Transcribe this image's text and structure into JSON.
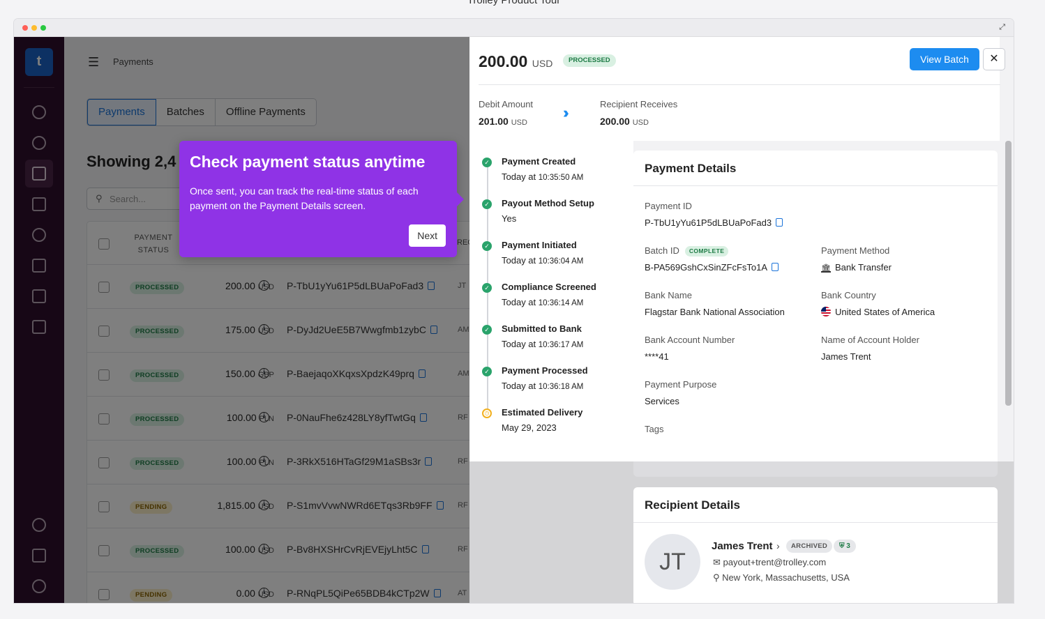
{
  "tour_title": "Trolley Product Tour",
  "app": {
    "logo_letter": "t",
    "breadcrumb": "Payments"
  },
  "tabs": [
    "Payments",
    "Batches",
    "Offline Payments"
  ],
  "showing": "Showing 2,4",
  "search_placeholder": "Search...",
  "table": {
    "header_status": "PAYMENT STATUS",
    "header_rec": "REC",
    "rows": [
      {
        "status": "PROCESSED",
        "amount": "200.00",
        "currency": "USD",
        "id": "P-TbU1yYu61P5dLBUaPoFad3",
        "rec": "JT"
      },
      {
        "status": "PROCESSED",
        "amount": "175.00",
        "currency": "USD",
        "id": "P-DyJd2UeE5B7Wwgfmb1zybC",
        "rec": "AM"
      },
      {
        "status": "PROCESSED",
        "amount": "150.00",
        "currency": "GBP",
        "id": "P-BaejaqoXKqxsXpdzK49prq",
        "rec": "AM"
      },
      {
        "status": "PROCESSED",
        "amount": "100.00",
        "currency": "PLN",
        "id": "P-0NauFhe6z428LY8yfTwtGq",
        "rec": "RF"
      },
      {
        "status": "PROCESSED",
        "amount": "100.00",
        "currency": "PLN",
        "id": "P-3RkX516HTaGf29M1aSBs3r",
        "rec": "RF"
      },
      {
        "status": "PENDING",
        "amount": "1,815.00",
        "currency": "USD",
        "id": "P-S1mvVvwNWRd6ETqs3Rb9FF",
        "rec": "RF"
      },
      {
        "status": "PROCESSED",
        "amount": "100.00",
        "currency": "USD",
        "id": "P-Bv8HXSHrCvRjEVEjyLht5C",
        "rec": "RF"
      },
      {
        "status": "PENDING",
        "amount": "0.00",
        "currency": "USD",
        "id": "P-RNqPL5QiPe65BDB4kCTp2W",
        "rec": "AT"
      }
    ]
  },
  "popover": {
    "title": "Check payment status anytime",
    "body": "Once sent, you can track the real-time status of each payment on the Payment Details screen.",
    "next": "Next",
    "color": "#8f33e6"
  },
  "panel": {
    "amount": "200.00",
    "currency": "USD",
    "status": "PROCESSED",
    "view_batch": "View Batch",
    "close": "✕",
    "debit_label": "Debit Amount",
    "debit_value": "201.00",
    "debit_currency": "USD",
    "recipient_label": "Recipient Receives",
    "recipient_value": "200.00",
    "recipient_currency": "USD",
    "timeline": [
      {
        "title": "Payment Created",
        "sub_main": "Today at ",
        "sub_time": "10:35:50 AM"
      },
      {
        "title": "Payout Method Setup",
        "sub_main": "Yes",
        "sub_time": ""
      },
      {
        "title": "Payment Initiated",
        "sub_main": "Today at ",
        "sub_time": "10:36:04 AM"
      },
      {
        "title": "Compliance Screened",
        "sub_main": "Today at ",
        "sub_time": "10:36:14 AM"
      },
      {
        "title": "Submitted to Bank",
        "sub_main": "Today at ",
        "sub_time": "10:36:17 AM"
      },
      {
        "title": "Payment Processed",
        "sub_main": "Today at ",
        "sub_time": "10:36:18 AM"
      },
      {
        "title": "Estimated Delivery",
        "sub_main": "May 29, 2023",
        "sub_time": ""
      }
    ],
    "details": {
      "title": "Payment Details",
      "payment_id_label": "Payment ID",
      "payment_id": "P-TbU1yYu61P5dLBUaPoFad3",
      "batch_id_label": "Batch ID",
      "batch_status": "COMPLETE",
      "batch_id": "B-PA569GshCxSinZFcFsTo1A",
      "payment_method_label": "Payment Method",
      "payment_method": "Bank Transfer",
      "bank_name_label": "Bank Name",
      "bank_name": "Flagstar Bank National Association",
      "bank_country_label": "Bank Country",
      "bank_country": "United States of America",
      "account_number_label": "Bank Account Number",
      "account_number": "****41",
      "account_holder_label": "Name of Account Holder",
      "account_holder": "James Trent",
      "purpose_label": "Payment Purpose",
      "purpose": "Services",
      "tags_label": "Tags"
    },
    "recipient": {
      "title": "Recipient Details",
      "initials": "JT",
      "name": "James Trent",
      "archived": "ARCHIVED",
      "verified_count": "3",
      "email": "payout+trent@trolley.com",
      "location": "New York, Massachusetts, USA"
    }
  }
}
